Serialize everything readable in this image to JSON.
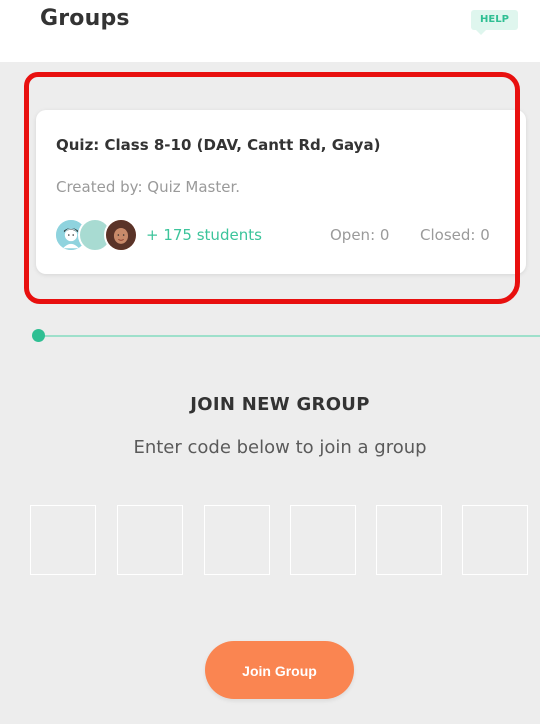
{
  "header": {
    "title": "Groups",
    "help_label": "HELP"
  },
  "group_card": {
    "name": "Quiz: Class 8-10 (DAV, Cantt Rd, Gaya)",
    "creator": "Created by: Quiz Master.",
    "student_count": "+ 175 students",
    "open_count": "Open: 0",
    "closed_count": "Closed: 0",
    "avatars": [
      "boy-avatar-icon",
      "blank-avatar-icon",
      "girl-avatar-icon"
    ]
  },
  "join": {
    "heading": "JOIN NEW GROUP",
    "subtitle": "Enter code below to join a group",
    "code_boxes": [
      "",
      "",
      "",
      "",
      "",
      ""
    ],
    "button_label": "Join Group"
  },
  "colors": {
    "accent_green": "#2fbf93",
    "button_orange": "#fa8551",
    "highlight_red": "#e8100f"
  }
}
